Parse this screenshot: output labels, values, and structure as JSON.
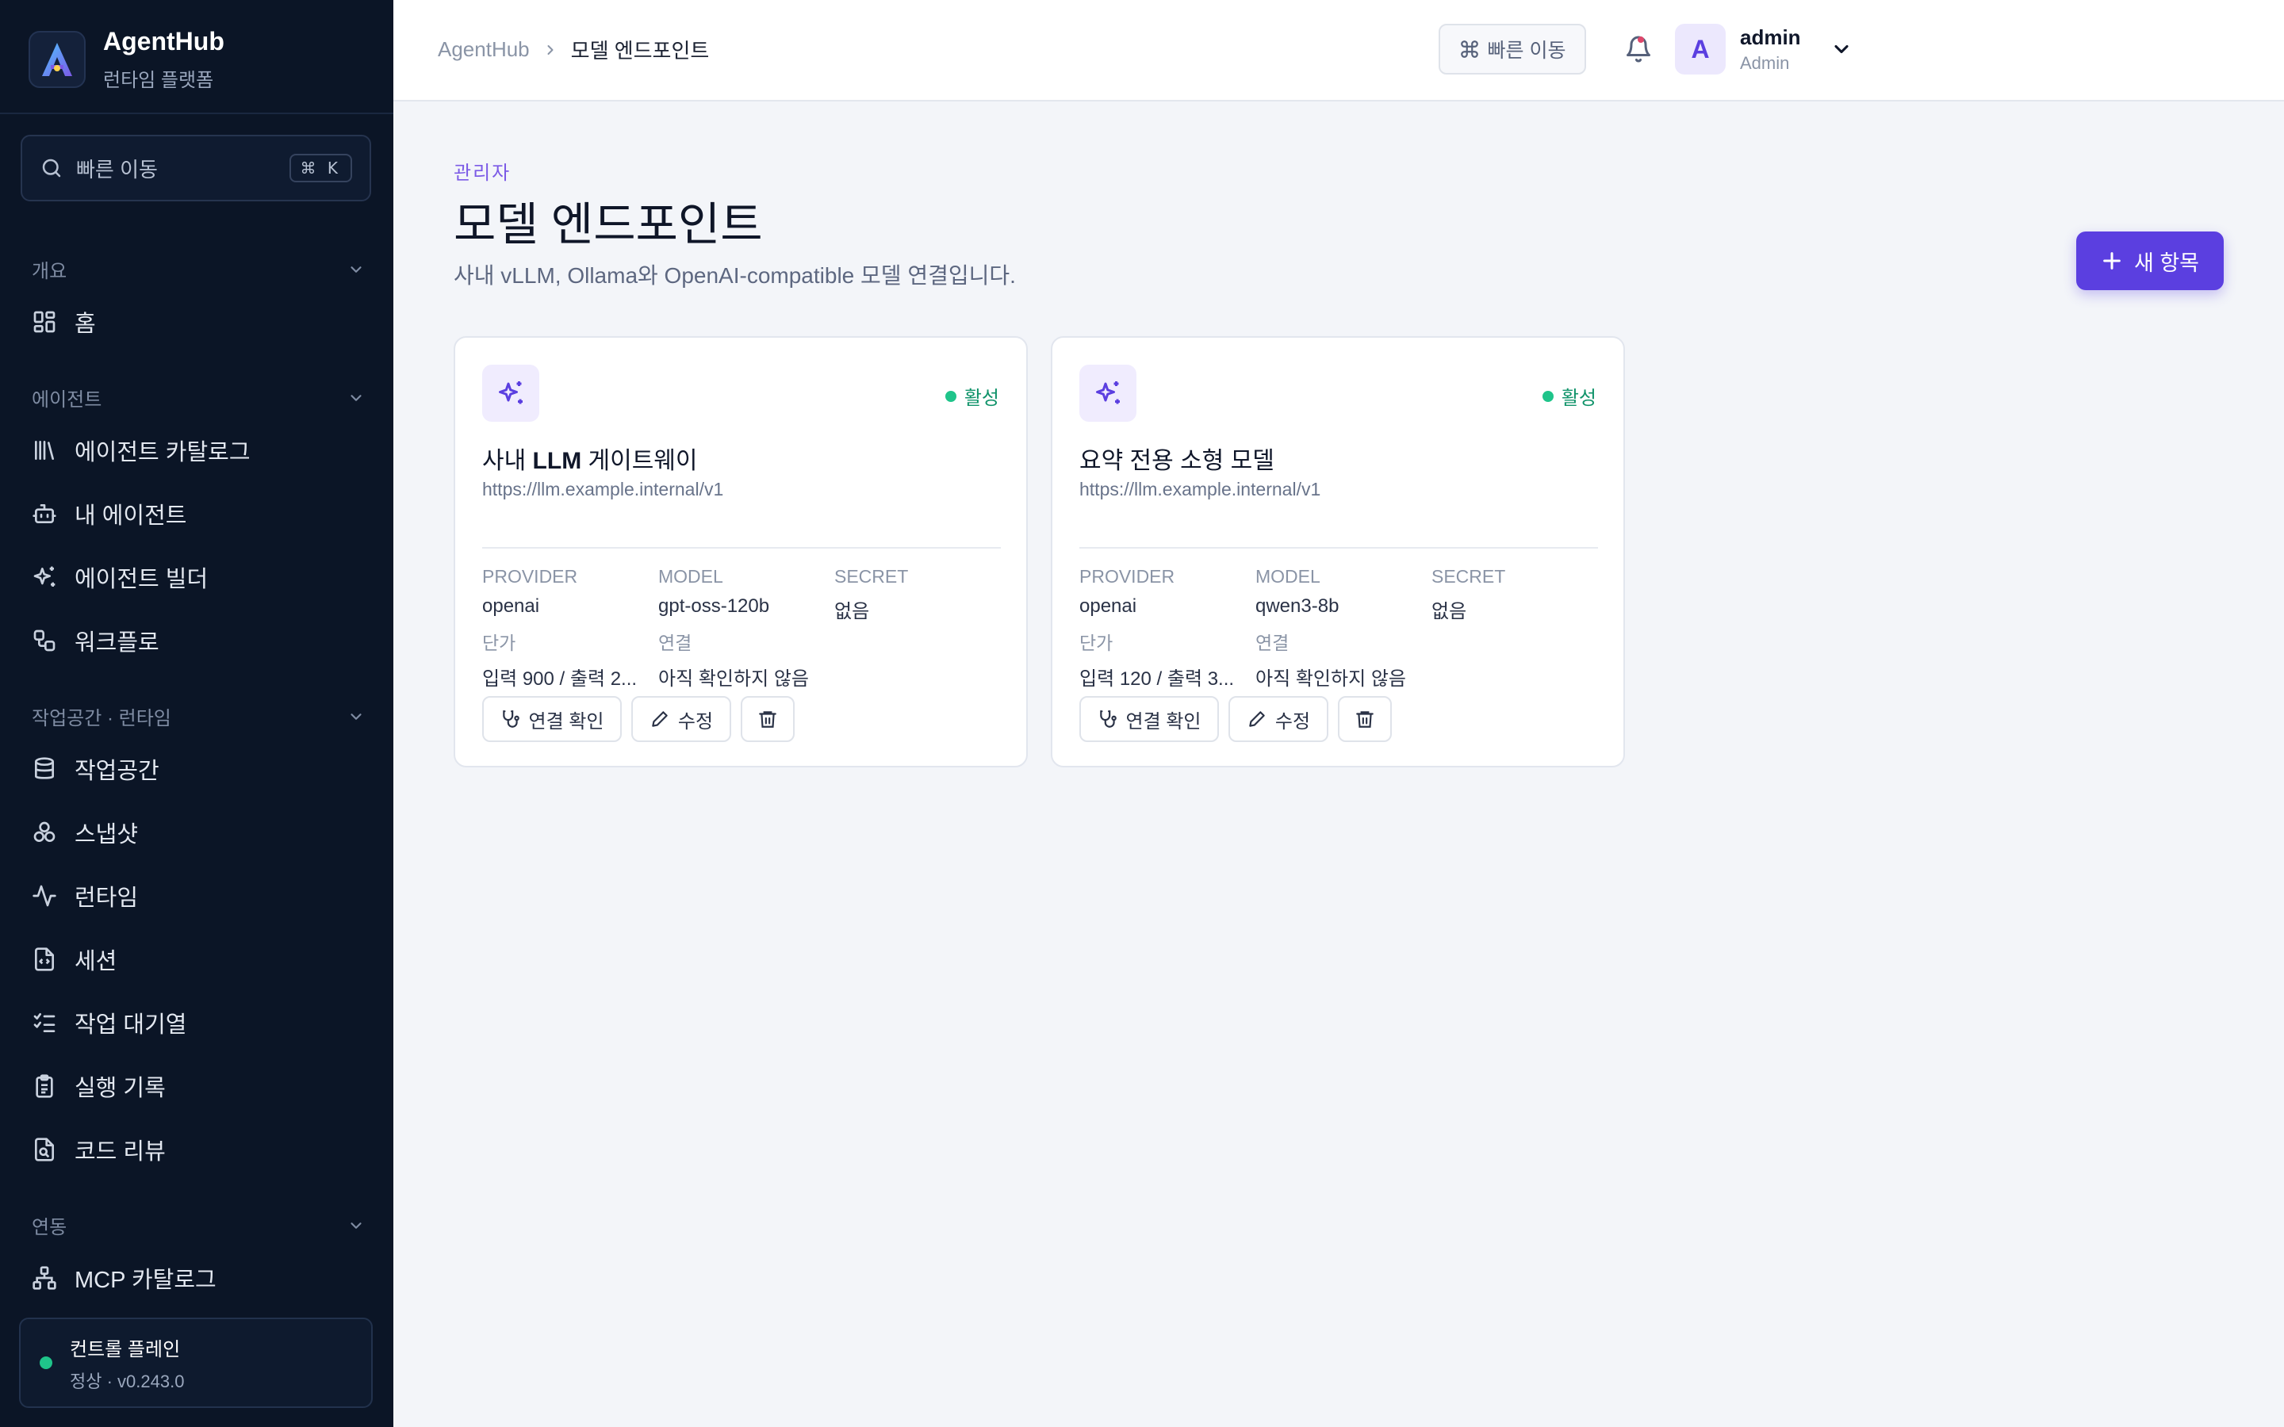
{
  "app": {
    "name": "AgentHub",
    "subtitle": "런타임 플랫폼"
  },
  "sidebar": {
    "search": {
      "label": "빠른 이동",
      "shortcut": "⌘ K"
    },
    "groups": [
      {
        "label": "개요",
        "items": [
          {
            "label": "홈",
            "icon": "dashboard-icon"
          }
        ]
      },
      {
        "label": "에이전트",
        "items": [
          {
            "label": "에이전트 카탈로그",
            "icon": "library-icon"
          },
          {
            "label": "내 에이전트",
            "icon": "bot-icon"
          },
          {
            "label": "에이전트 빌더",
            "icon": "sparkles-icon"
          },
          {
            "label": "워크플로",
            "icon": "workflow-icon"
          }
        ]
      },
      {
        "label": "작업공간 · 런타임",
        "items": [
          {
            "label": "작업공간",
            "icon": "database-icon"
          },
          {
            "label": "스냅샷",
            "icon": "boxes-icon"
          },
          {
            "label": "런타임",
            "icon": "activity-icon"
          },
          {
            "label": "세션",
            "icon": "file-code-icon"
          },
          {
            "label": "작업 대기열",
            "icon": "list-checks-icon"
          },
          {
            "label": "실행 기록",
            "icon": "clipboard-icon"
          },
          {
            "label": "코드 리뷰",
            "icon": "file-search-icon"
          }
        ]
      },
      {
        "label": "연동",
        "items": [
          {
            "label": "MCP 카탈로그",
            "icon": "network-icon"
          }
        ]
      }
    ],
    "status": {
      "title": "컨트롤 플레인",
      "detail": "정상 · v0.243.0",
      "color": "#1fc48a"
    }
  },
  "topbar": {
    "breadcrumb": {
      "root": "AgentHub",
      "current": "모델 엔드포인트"
    },
    "quick_jump": "빠른 이동",
    "user": {
      "initial": "A",
      "name": "admin",
      "role": "Admin"
    }
  },
  "page": {
    "eyebrow": "관리자",
    "title": "모델 엔드포인트",
    "subtitle": "사내 vLLM, Ollama와 OpenAI-compatible 모델 연결입니다.",
    "new_button": "새 항목"
  },
  "labels": {
    "provider": "PROVIDER",
    "model": "MODEL",
    "secret": "SECRET",
    "price": "단가",
    "connection": "연결",
    "test": "연결 확인",
    "edit": "수정"
  },
  "cards": [
    {
      "title_pre": "사내 ",
      "title_bold": "LLM",
      "title_post": " 게이트웨이",
      "url": "https://llm.example.internal/v1",
      "status": "활성",
      "provider": "openai",
      "model": "gpt-oss-120b",
      "secret": "없음",
      "price": "입력 900 / 출력 2...",
      "connection": "아직 확인하지 않음"
    },
    {
      "title_pre": "요약 전용 소형 모델",
      "title_bold": "",
      "title_post": "",
      "url": "https://llm.example.internal/v1",
      "status": "활성",
      "provider": "openai",
      "model": "qwen3-8b",
      "secret": "없음",
      "price": "입력 120 / 출력 3...",
      "connection": "아직 확인하지 않음"
    }
  ],
  "colors": {
    "accent": "#5b3fe0",
    "active": "#1fc48a",
    "sidebar_bg": "#0b1526"
  }
}
